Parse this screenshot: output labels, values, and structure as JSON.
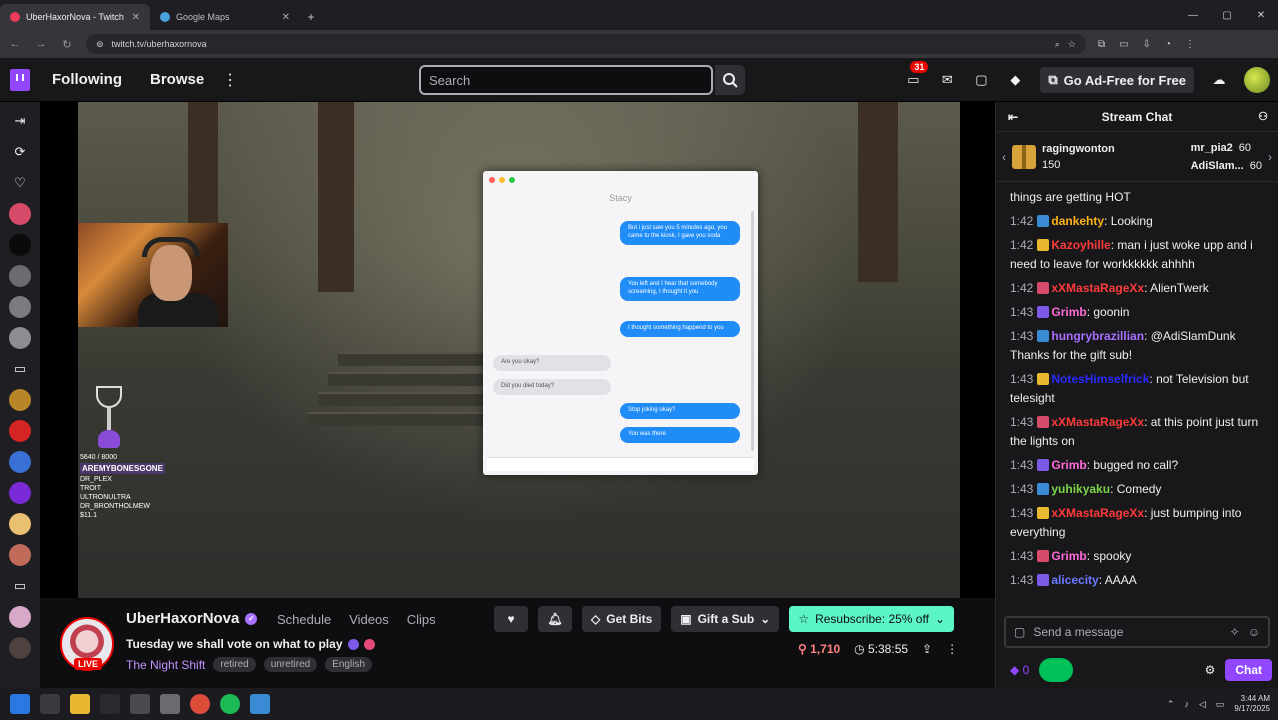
{
  "browser": {
    "tabs": [
      {
        "title": "UberHaxorNova - Twitch",
        "active": true
      },
      {
        "title": "Google Maps",
        "active": false
      }
    ],
    "new_tab": "+",
    "url": "twitch.tv/uberhaxornova"
  },
  "nav": {
    "following": "Following",
    "browse": "Browse",
    "search_placeholder": "Search",
    "notifications_count": "31",
    "go_ad_free": "Go Ad-Free for Free"
  },
  "video": {
    "text_window": {
      "title": "Stacy",
      "bubbles": [
        {
          "from": "me",
          "text": "But i just saw you 5 minutes ago, you came to the kiosk, I gave you soda"
        },
        {
          "from": "me",
          "text": "You left and I hear that somebody screaming, I thought it you"
        },
        {
          "from": "me",
          "text": "I thought something happend to you"
        },
        {
          "from": "them",
          "text": "Are you okay?"
        },
        {
          "from": "them",
          "text": "Did you died today?"
        },
        {
          "from": "me",
          "text": "Stop joking okay?"
        },
        {
          "from": "me",
          "text": "You was there"
        }
      ]
    },
    "overlay": {
      "progress": "5640 / 8000",
      "top_line": "AREMYBONESGONE",
      "lines": [
        "DR_PLEX",
        "TROIT",
        "ULTRONULTRA",
        "DR_BRONTHOLMEW",
        "$11.1"
      ]
    }
  },
  "channel": {
    "name": "UberHaxorNova",
    "live": "LIVE",
    "links": [
      "Schedule",
      "Videos",
      "Clips"
    ],
    "title": "Tuesday we shall vote on what to play",
    "category": "The Night Shift",
    "tags": [
      "retired",
      "unretired",
      "English"
    ],
    "get_bits": "Get Bits",
    "gift_sub": "Gift a Sub",
    "resub": "Resubscribe: 25% off",
    "viewers": "1,710",
    "uptime": "5:38:55"
  },
  "chat": {
    "header": "Stream Chat",
    "leaderboard": {
      "gifter": "ragingwonton",
      "gifter_count": "150",
      "others": [
        {
          "name": "mr_pia2",
          "count": "60"
        },
        {
          "name": "AdiSlam...",
          "count": "60"
        }
      ]
    },
    "messages": [
      {
        "time": "",
        "user": "",
        "user_color": "#efeff1",
        "text": "things are getting HOT"
      },
      {
        "time": "1:42",
        "user": "dankehty",
        "user_color": "#ffb31a",
        "text": "Looking"
      },
      {
        "time": "1:42",
        "user": "Kazoyhille",
        "user_color": "#ff3a3a",
        "text": "man i just woke upp and i need to leave for workkkkkk ahhhh"
      },
      {
        "time": "1:42",
        "user": "xXMastaRageXx",
        "user_color": "#ff3a3a",
        "text": "AlienTwerk"
      },
      {
        "time": "1:43",
        "user": "Grimb",
        "user_color": "#ff6bd8",
        "text": "goonin"
      },
      {
        "time": "1:43",
        "user": "hungrybrazillian",
        "user_color": "#a970ff",
        "text": "@AdiSlamDunk Thanks for the gift sub!"
      },
      {
        "time": "1:43",
        "user": "NotesHimselfrick",
        "user_color": "#2a2aff",
        "text": "not Television but telesight"
      },
      {
        "time": "1:43",
        "user": "xXMastaRageXx",
        "user_color": "#ff3a3a",
        "text": "at this point just turn the lights on"
      },
      {
        "time": "1:43",
        "user": "Grimb",
        "user_color": "#ff6bd8",
        "text": "bugged no call?"
      },
      {
        "time": "1:43",
        "user": "yuhikyaku",
        "user_color": "#7cd64a",
        "text": "Comedy"
      },
      {
        "time": "1:43",
        "user": "xXMastaRageXx",
        "user_color": "#ff3a3a",
        "text": "just bumping into everything"
      },
      {
        "time": "1:43",
        "user": "Grimb",
        "user_color": "#ff6bd8",
        "text": "spooky"
      },
      {
        "time": "1:43",
        "user": "alicecity",
        "user_color": "#6b7bff",
        "text": "AAAA"
      }
    ],
    "input_placeholder": "Send a message",
    "points": "0",
    "chat_button": "Chat"
  },
  "taskbar": {
    "time": "3:44 AM",
    "date": "9/17/2025"
  }
}
